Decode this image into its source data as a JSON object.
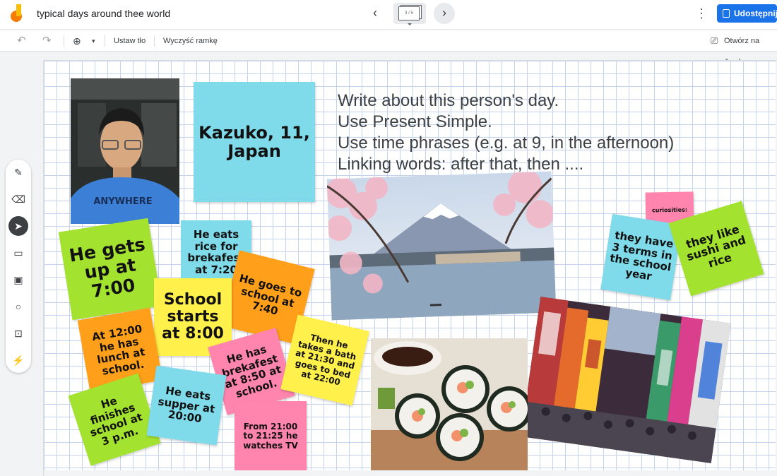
{
  "header": {
    "title": "typical days around thee world",
    "frame_counter": "3 / 5",
    "share_label": "Udostępnij"
  },
  "toolbar": {
    "set_background": "Ustaw tło",
    "clear_frame": "Wyczyść ramkę",
    "open_on_jamboard": "Otwórz na Jamb"
  },
  "board": {
    "title_note": "Kazuko, 11, Japan",
    "instructions": [
      "Write about this person's day.",
      "Use Present Simple.",
      "Use time phrases (e.g. at 9, in the afternoon)",
      "Linking words: after that, then ...."
    ],
    "notes": {
      "gets_up": "He gets up at 7:00",
      "eats_rice": "He eats rice for brekafest at 7:20",
      "goes_school": "He goes to school at 7:40",
      "school_starts": "School starts at 8:00",
      "lunch": "At 12:00 he has lunch at school.",
      "brekafest": "He has brekafest at 8:50 at school.",
      "bath": "Then he takes a bath at 21:30 and goes to bed at 22:00",
      "finishes": "He finishes school at 3 p.m.",
      "supper": "He eats supper at 20:00",
      "tv": "From 21:00 to 21:25 he watches TV",
      "curiosities": "curiosities:",
      "terms": "they have 3 terms in the school year",
      "sushi": "they like sushi and rice"
    }
  },
  "colors": {
    "cyan": "#7fdbe9",
    "green": "#a3e22f",
    "yellow": "#fff04b",
    "orange": "#ff9f1a",
    "pink": "#ff84ae",
    "accent": "#1a73e8"
  }
}
